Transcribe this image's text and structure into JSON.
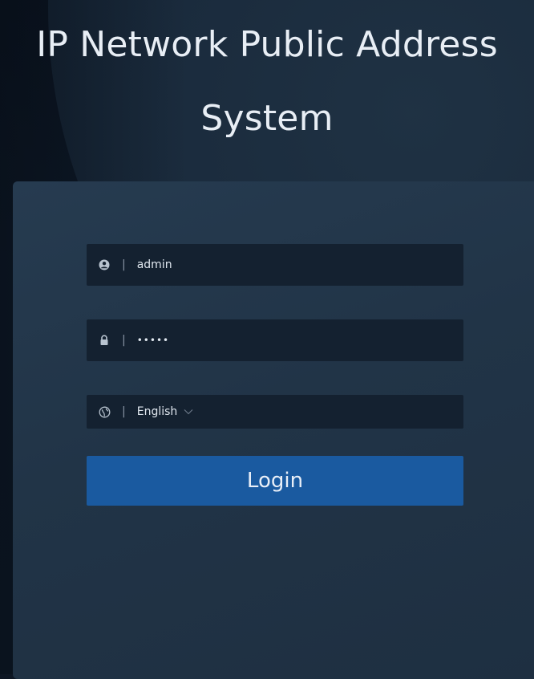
{
  "header": {
    "title_line1": "IP Network Public Address",
    "title_line2": "System"
  },
  "form": {
    "username": {
      "value": "admin",
      "icon": "user-circle-icon"
    },
    "password": {
      "value": "•••••",
      "icon": "lock-icon"
    },
    "language": {
      "value": "English",
      "icon": "globe-icon",
      "chevron": "chevron-down-icon"
    },
    "separator": "|",
    "login_label": "Login"
  },
  "colors": {
    "background": "#0d1623",
    "panel": "#223548",
    "field": "#142130",
    "button": "#1a5aa0",
    "text": "#e8eef5"
  }
}
